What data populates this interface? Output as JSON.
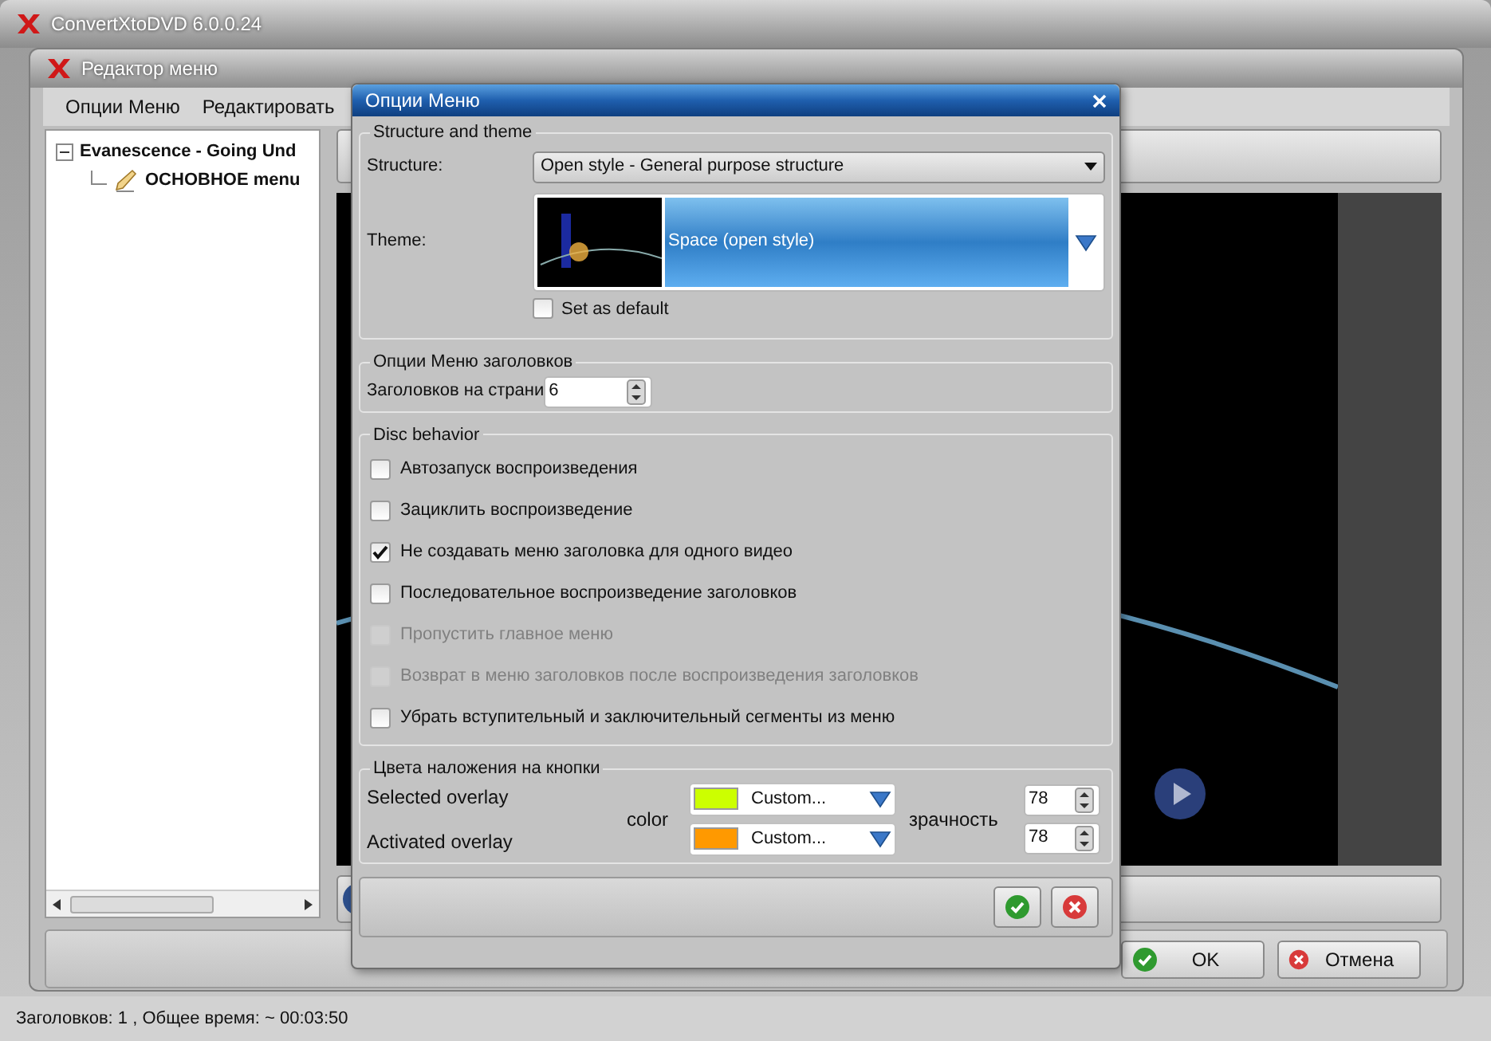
{
  "app_window": {
    "title": "ConvertXtoDVD 6.0.0.24"
  },
  "editor_window": {
    "title": "Редактор меню",
    "menu": [
      "Опции Меню",
      "Редактировать"
    ],
    "tree": [
      {
        "label": "Evanescence - Going Und",
        "expanded": true,
        "children": [
          {
            "label": "ОСНОВНОЕ menu"
          }
        ]
      }
    ],
    "buttons": [
      {
        "label": "OK",
        "kind": "ok"
      },
      {
        "label": "Отмена",
        "kind": "cancel"
      }
    ]
  },
  "dialog": {
    "title": "Опции Меню",
    "structure_section": {
      "title": "Structure and theme",
      "structure_label": "Structure:",
      "structure_value": "Open style - General purpose structure",
      "theme_label": "Theme:",
      "theme_value": "Space (open style)",
      "set_default": {
        "label": "Set as default",
        "checked": false
      }
    },
    "titles_section": {
      "title": "Опции Меню заголовков",
      "label": "Заголовков на страни",
      "value": "6"
    },
    "disc_section": {
      "title": "Disc behavior",
      "options": [
        {
          "label": "Автозапуск воспроизведения",
          "checked": false,
          "disabled": false
        },
        {
          "label": "Зациклить воспроизведение",
          "checked": false,
          "disabled": false
        },
        {
          "label": "Не создавать меню заголовка для одного видео",
          "checked": true,
          "disabled": false
        },
        {
          "label": "Последовательное воспроизведение заголовков",
          "checked": false,
          "disabled": false
        },
        {
          "label": "Пропустить главное меню",
          "checked": false,
          "disabled": true
        },
        {
          "label": "Возврат в меню заголовков после воспроизведения заголовков",
          "checked": false,
          "disabled": true
        },
        {
          "label": "Убрать вступительный и заключительный сегменты из меню",
          "checked": false,
          "disabled": false
        }
      ]
    },
    "overlay_section": {
      "title": "Цвета наложения на кнопки",
      "color_label": "color",
      "transparency_label": "зрачность",
      "rows": [
        {
          "label": "Selected overlay",
          "color": "#ccff00",
          "value": "Custom...",
          "transparency": "78"
        },
        {
          "label": "Activated overlay",
          "color": "#ff9900",
          "value": "Custom...",
          "transparency": "78"
        }
      ]
    },
    "footer_buttons": [
      {
        "kind": "ok"
      },
      {
        "kind": "cancel"
      }
    ]
  },
  "status_bar": "Заголовков: 1 , Общее время: ~ 00:03:50"
}
